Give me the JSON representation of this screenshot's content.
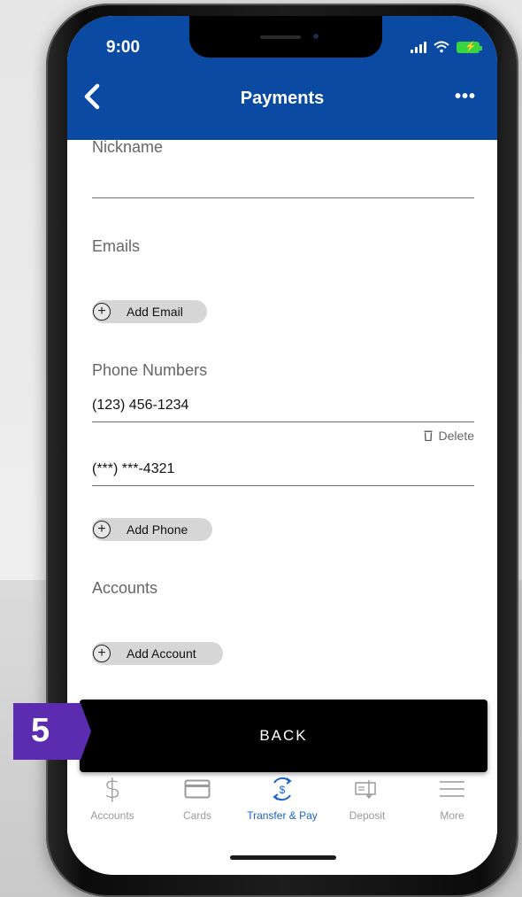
{
  "status_bar": {
    "time": "9:00"
  },
  "header": {
    "title": "Payments",
    "more": "•••"
  },
  "form": {
    "nickname": {
      "label": "Nickname",
      "value": ""
    },
    "emails": {
      "label": "Emails",
      "add_label": "Add Email"
    },
    "phones": {
      "label": "Phone Numbers",
      "numbers": [
        "(123) 456-1234",
        "(***) ***-4321"
      ],
      "delete_label": "Delete",
      "add_label": "Add Phone"
    },
    "accounts": {
      "label": "Accounts",
      "add_label": "Add Account"
    }
  },
  "back_button": {
    "label": "BACK"
  },
  "step_badge": {
    "number": "5",
    "color": "#5b2bb0"
  },
  "tabs": [
    {
      "label": "Accounts",
      "icon": "dollar-icon",
      "active": false
    },
    {
      "label": "Cards",
      "icon": "card-icon",
      "active": false
    },
    {
      "label": "Transfer & Pay",
      "icon": "transfer-pay-icon",
      "active": true
    },
    {
      "label": "Deposit",
      "icon": "check-deposit-icon",
      "active": false
    },
    {
      "label": "More",
      "icon": "menu-icon",
      "active": false
    }
  ],
  "colors": {
    "header_bg": "#0a4aa3",
    "active_tab": "#1a63c6",
    "inactive_tab": "#9a9a9a"
  }
}
